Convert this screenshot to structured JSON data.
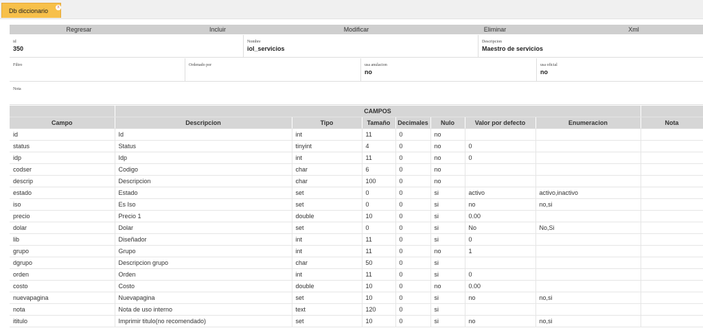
{
  "tab": {
    "label": "Db diccionario",
    "close": "x"
  },
  "toolbar": {
    "regresar": "Regresar",
    "incluir": "Incluir",
    "modificar": "Modificar",
    "eliminar": "Eliminar",
    "xml": "Xml"
  },
  "record": {
    "id_label": "id",
    "id_value": "350",
    "nombre_label": "Nombre",
    "nombre_value": "iol_servicios",
    "descripcion_label": "Descripcion",
    "descripcion_value": "Maestro de servicios",
    "filtro_label": "Filtro",
    "filtro_value": "",
    "ordenado_label": "Ordenado por",
    "ordenado_value": "",
    "anulacion_label": "usa anulacion",
    "anulacion_value": "no",
    "oficial_label": "usa oficial",
    "oficial_value": "no",
    "nota_label": "Nota",
    "nota_value": ""
  },
  "table": {
    "title": "CAMPOS",
    "headers": [
      "Campo",
      "Descripcion",
      "Tipo",
      "Tamaño",
      "Decimales",
      "Nulo",
      "Valor por defecto",
      "Enumeracion",
      "Nota"
    ],
    "rows": [
      [
        "id",
        "Id",
        "int",
        "11",
        "0",
        "no",
        "",
        "",
        ""
      ],
      [
        "status",
        "Status",
        "tinyint",
        "4",
        "0",
        "no",
        "0",
        "",
        ""
      ],
      [
        "idp",
        "Idp",
        "int",
        "11",
        "0",
        "no",
        "0",
        "",
        ""
      ],
      [
        "codser",
        "Codigo",
        "char",
        "6",
        "0",
        "no",
        "",
        "",
        ""
      ],
      [
        "descrip",
        "Descripcion",
        "char",
        "100",
        "0",
        "no",
        "",
        "",
        ""
      ],
      [
        "estado",
        "Estado",
        "set",
        "0",
        "0",
        "si",
        "activo",
        "activo,inactivo",
        ""
      ],
      [
        "iso",
        "Es Iso",
        "set",
        "0",
        "0",
        "si",
        "no",
        "no,si",
        ""
      ],
      [
        "precio",
        "Precio 1",
        "double",
        "10",
        "0",
        "si",
        "0.00",
        "",
        ""
      ],
      [
        "dolar",
        "Dolar",
        "set",
        "0",
        "0",
        "si",
        "No",
        "No,Si",
        ""
      ],
      [
        "lib",
        "Diseñador",
        "int",
        "11",
        "0",
        "si",
        "0",
        "",
        ""
      ],
      [
        "grupo",
        "Grupo",
        "int",
        "11",
        "0",
        "no",
        "1",
        "",
        ""
      ],
      [
        "dgrupo",
        "Descripcion grupo",
        "char",
        "50",
        "0",
        "si",
        "",
        "",
        ""
      ],
      [
        "orden",
        "Orden",
        "int",
        "11",
        "0",
        "si",
        "0",
        "",
        ""
      ],
      [
        "costo",
        "Costo",
        "double",
        "10",
        "0",
        "no",
        "0.00",
        "",
        ""
      ],
      [
        "nuevapagina",
        "Nuevapagina",
        "set",
        "10",
        "0",
        "si",
        "no",
        "no,si",
        ""
      ],
      [
        "nota",
        "Nota de uso interno",
        "text",
        "120",
        "0",
        "si",
        "",
        "",
        ""
      ],
      [
        "ititulo",
        "Imprimir titulo(no recomendado)",
        "set",
        "10",
        "0",
        "si",
        "no",
        "no,si",
        ""
      ]
    ]
  }
}
